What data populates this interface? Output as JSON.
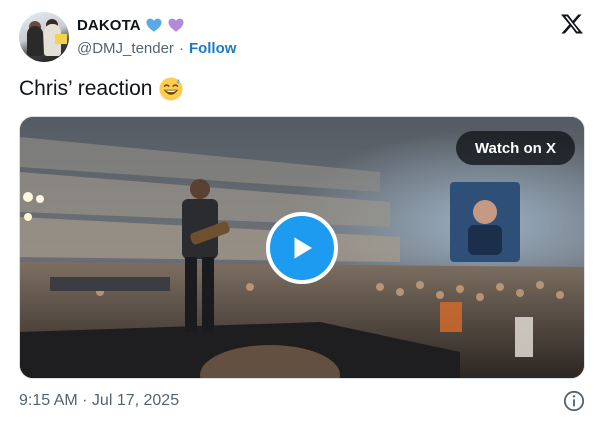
{
  "author": {
    "display_name": "DAKOTA",
    "handle": "@DMJ_tender",
    "separator": "·",
    "follow_label": "Follow",
    "badges": [
      "blue-heart-icon",
      "purple-heart-icon"
    ]
  },
  "tweet": {
    "text": "Chris’ reaction",
    "emoji": "grinning-sweat-face-icon"
  },
  "media": {
    "watch_label": "Watch on X",
    "play_icon": "play-icon"
  },
  "footer": {
    "timestamp": "9:15 AM · Jul 17, 2025",
    "info_icon": "info-icon"
  },
  "colors": {
    "follow": "#1d7bc4",
    "play_button": "#1d9bf0",
    "secondary_text": "#536471",
    "blue_heart": "#5aa8e6",
    "purple_heart": "#b18ad8"
  }
}
